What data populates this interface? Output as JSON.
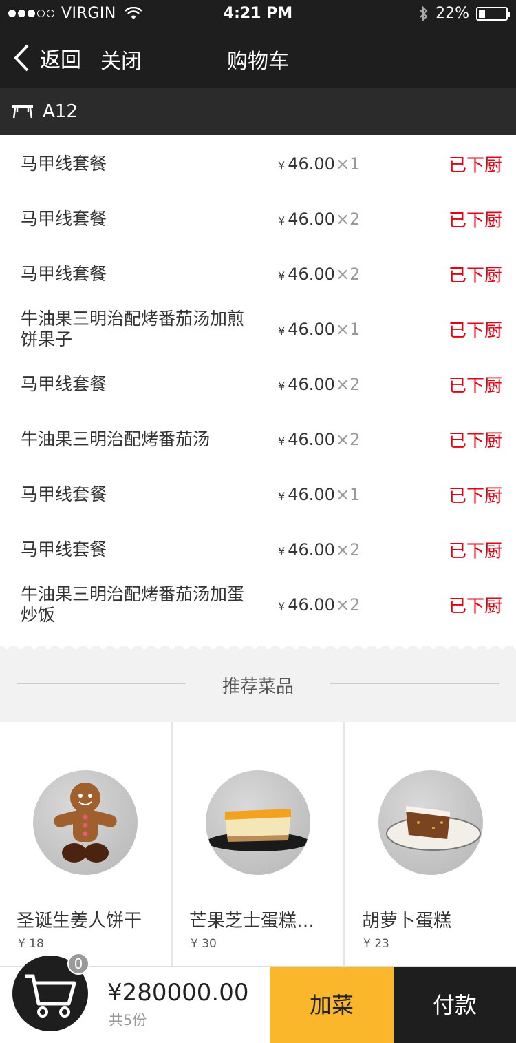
{
  "status_bar": {
    "carrier": "VIRGIN",
    "time": "4:21 PM",
    "battery": "22%"
  },
  "nav": {
    "back_label": "返回",
    "close_label": "关闭",
    "title": "购物车"
  },
  "table": {
    "label": "A12"
  },
  "orders": [
    {
      "name": "马甲线套餐",
      "currency": "¥",
      "price": "46.00",
      "qty": "×1",
      "status": "已下厨"
    },
    {
      "name": "马甲线套餐",
      "currency": "¥",
      "price": "46.00",
      "qty": "×2",
      "status": "已下厨"
    },
    {
      "name": "马甲线套餐",
      "currency": "¥",
      "price": "46.00",
      "qty": "×2",
      "status": "已下厨"
    },
    {
      "name": "牛油果三明治配烤番茄汤加煎饼果子",
      "currency": "¥",
      "price": "46.00",
      "qty": "×1",
      "status": "已下厨"
    },
    {
      "name": "马甲线套餐",
      "currency": "¥",
      "price": "46.00",
      "qty": "×2",
      "status": "已下厨"
    },
    {
      "name": "牛油果三明治配烤番茄汤",
      "currency": "¥",
      "price": "46.00",
      "qty": "×2",
      "status": "已下厨"
    },
    {
      "name": "马甲线套餐",
      "currency": "¥",
      "price": "46.00",
      "qty": "×1",
      "status": "已下厨"
    },
    {
      "name": "马甲线套餐",
      "currency": "¥",
      "price": "46.00",
      "qty": "×2",
      "status": "已下厨"
    },
    {
      "name": "牛油果三明治配烤番茄汤加蛋炒饭",
      "currency": "¥",
      "price": "46.00",
      "qty": "×2",
      "status": "已下厨"
    }
  ],
  "recommend": {
    "title": "推荐菜品",
    "dishes": [
      {
        "name": "圣诞生姜人饼干",
        "price": "¥ 18",
        "image": "gingerbread-man"
      },
      {
        "name": "芒果芝士蛋糕…",
        "price": "¥ 30",
        "image": "mango-cheesecake"
      },
      {
        "name": "胡萝卜蛋糕",
        "price": "¥ 23",
        "image": "carrot-cake"
      }
    ]
  },
  "cart": {
    "badge": "0",
    "total": "¥280000.00",
    "count": "共5份"
  },
  "actions": {
    "add_label": "加菜",
    "pay_label": "付款"
  },
  "colors": {
    "dark": "#1e1e1e",
    "accent": "#fbb72c",
    "status_red": "#e60012"
  }
}
